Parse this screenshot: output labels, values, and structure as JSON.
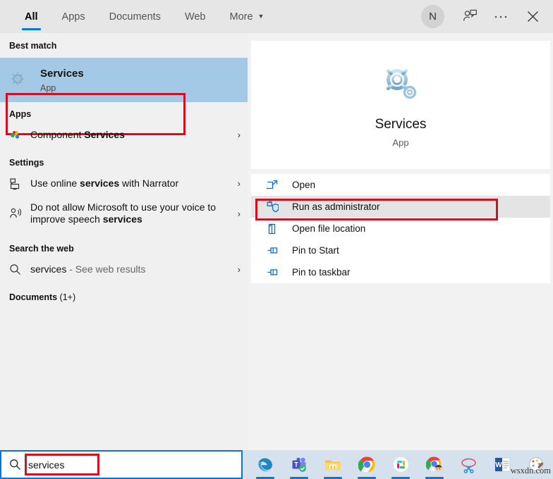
{
  "window": {
    "tabs": [
      {
        "label": "All",
        "active": true
      },
      {
        "label": "Apps",
        "active": false
      },
      {
        "label": "Documents",
        "active": false
      },
      {
        "label": "Web",
        "active": false
      },
      {
        "label": "More",
        "active": false,
        "chevron": "▼"
      }
    ],
    "avatar_initial": "N",
    "feedback_icon": "person-feedback-icon",
    "more_icon": "ellipsis-icon",
    "close_icon": "close-icon"
  },
  "results": {
    "best_match_header": "Best match",
    "best_match": {
      "title": "Services",
      "subtitle": "App",
      "icon": "services-gear-icon"
    },
    "apps_header": "Apps",
    "apps": [
      {
        "prefix": "Component ",
        "bold": "Services",
        "suffix": "",
        "icon": "component-services-icon",
        "arrow": "›"
      }
    ],
    "settings_header": "Settings",
    "settings": [
      {
        "prefix": "Use online ",
        "bold": "services",
        "suffix": " with Narrator",
        "icon": "narrator-icon",
        "arrow": "›"
      },
      {
        "prefix": "Do not allow Microsoft to use your voice to improve speech ",
        "bold": "services",
        "suffix": "",
        "icon": "speech-icon",
        "arrow": "›"
      }
    ],
    "web_header": "Search the web",
    "web": [
      {
        "prefix": "",
        "bold": "",
        "plain": "services",
        "suffix": " - See web results",
        "icon": "search-icon",
        "arrow": "›"
      }
    ],
    "documents_header_bold": "Documents",
    "documents_header_count": " (1+)"
  },
  "preview": {
    "app_name": "Services",
    "app_type": "App",
    "app_icon": "services-gear-icon",
    "actions": [
      {
        "label": "Open",
        "icon": "open-external-icon",
        "highlighted": false
      },
      {
        "label": "Run as administrator",
        "icon": "shield-admin-icon",
        "highlighted": true
      },
      {
        "label": "Open file location",
        "icon": "folder-location-icon",
        "highlighted": false
      },
      {
        "label": "Pin to Start",
        "icon": "pin-icon",
        "highlighted": false
      },
      {
        "label": "Pin to taskbar",
        "icon": "pin-icon",
        "highlighted": false
      }
    ]
  },
  "taskbar": {
    "search_value": "services",
    "search_icon": "search-icon",
    "apps": [
      {
        "name": "microsoft-edge",
        "running": true
      },
      {
        "name": "microsoft-teams",
        "running": true
      },
      {
        "name": "file-explorer",
        "running": true
      },
      {
        "name": "google-chrome",
        "running": true
      },
      {
        "name": "slack",
        "running": true
      },
      {
        "name": "chrome-profile",
        "running": true
      },
      {
        "name": "snipping-tool",
        "running": false
      },
      {
        "name": "microsoft-word",
        "running": false
      },
      {
        "name": "paint",
        "running": false
      }
    ],
    "watermark": "wsxdn.com"
  },
  "annotations": {
    "accent_blue": "#0078d7",
    "selection_blue": "#a3c9e6",
    "highlight_red": "#cf1020"
  }
}
